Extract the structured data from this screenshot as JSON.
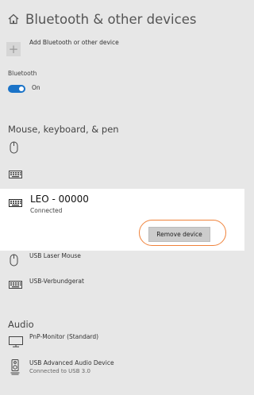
{
  "header": {
    "title": "Bluetooth & other devices"
  },
  "add_device": {
    "label": "Add Bluetooth or other device"
  },
  "bluetooth": {
    "section_label": "Bluetooth",
    "toggle_label": "On"
  },
  "sections": {
    "mouse": "Mouse, keyboard, & pen",
    "audio": "Audio"
  },
  "selected_device": {
    "name": "LEO - 00000",
    "status": "Connected",
    "remove_label": "Remove device"
  },
  "devices": [
    {
      "name": "USB Laser Mouse",
      "icon": "mouse-icon"
    },
    {
      "name": "USB-Verbundgerat",
      "icon": "keyboard-icon"
    }
  ],
  "audio_devices": [
    {
      "name": "PnP-Monitor (Standard)",
      "icon": "monitor-icon"
    },
    {
      "name": "USB Advanced Audio Device",
      "sub": "Connected to USB 3.0",
      "icon": "speaker-icon"
    }
  ],
  "colors": {
    "toggle": "#1a73c8",
    "highlight": "#f0823a",
    "background": "#e7e7e7"
  }
}
